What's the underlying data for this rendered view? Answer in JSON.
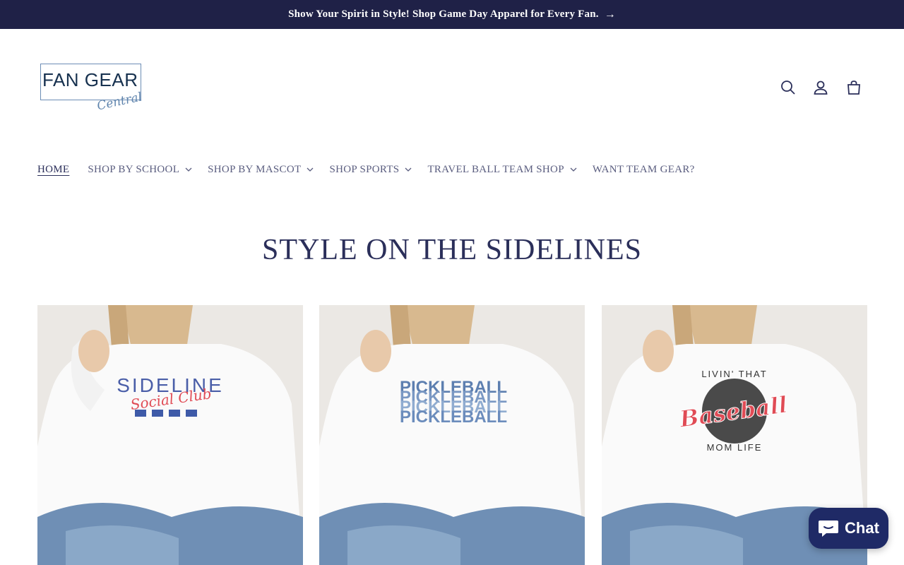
{
  "announcement": {
    "text": "Show Your Spirit in Style! Shop Game Day Apparel for Every Fan.",
    "arrow": "→"
  },
  "logo": {
    "brand": "FAN GEAR",
    "sub": "Central"
  },
  "header_icons": [
    "search-icon",
    "account-icon",
    "cart-icon"
  ],
  "nav": {
    "items": [
      {
        "label": "HOME",
        "has_dropdown": false,
        "active": true
      },
      {
        "label": "SHOP BY SCHOOL",
        "has_dropdown": true
      },
      {
        "label": "SHOP BY MASCOT",
        "has_dropdown": true
      },
      {
        "label": "SHOP SPORTS",
        "has_dropdown": true
      },
      {
        "label": "TRAVEL BALL TEAM SHOP",
        "has_dropdown": true
      },
      {
        "label": "WANT TEAM GEAR?",
        "has_dropdown": false
      }
    ]
  },
  "section": {
    "title": "STYLE ON THE SIDELINES"
  },
  "products": [
    {
      "design_line1": "SIDELINE",
      "design_line2": "Social Club"
    },
    {
      "design_line1": "PICKLEBALL"
    },
    {
      "design_line1": "LIVIN' THAT",
      "design_line2": "Baseball",
      "design_line3": "MOM LIFE"
    }
  ],
  "chat": {
    "label": "Chat"
  },
  "colors": {
    "announcement_bg": "#1f2147",
    "text_primary": "#2b2f5a",
    "chat_bg": "#1f2a66"
  }
}
